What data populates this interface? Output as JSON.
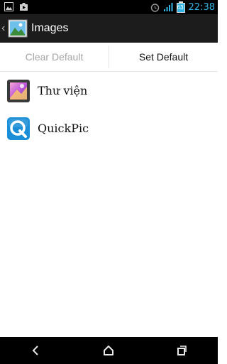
{
  "status_bar": {
    "time": "22:38",
    "battery_level": "63",
    "icons": [
      "image-notification-icon",
      "play-store-notification-icon",
      "alarm-icon",
      "signal-icon",
      "battery-icon"
    ]
  },
  "action_bar": {
    "title": "Images"
  },
  "buttons": {
    "clear_default": "Clear Default",
    "set_default": "Set Default"
  },
  "apps": [
    {
      "label": "Thư viện",
      "icon": "gallery-icon"
    },
    {
      "label": "QuickPic",
      "icon": "quickpic-icon"
    }
  ],
  "nav_bar": {
    "icons": [
      "back-icon",
      "home-icon",
      "recents-icon"
    ]
  },
  "colors": {
    "accent": "#33b5e5",
    "action_bar_bg": "#1c1c1c",
    "quickpic_blue": "#1a8fd8"
  }
}
